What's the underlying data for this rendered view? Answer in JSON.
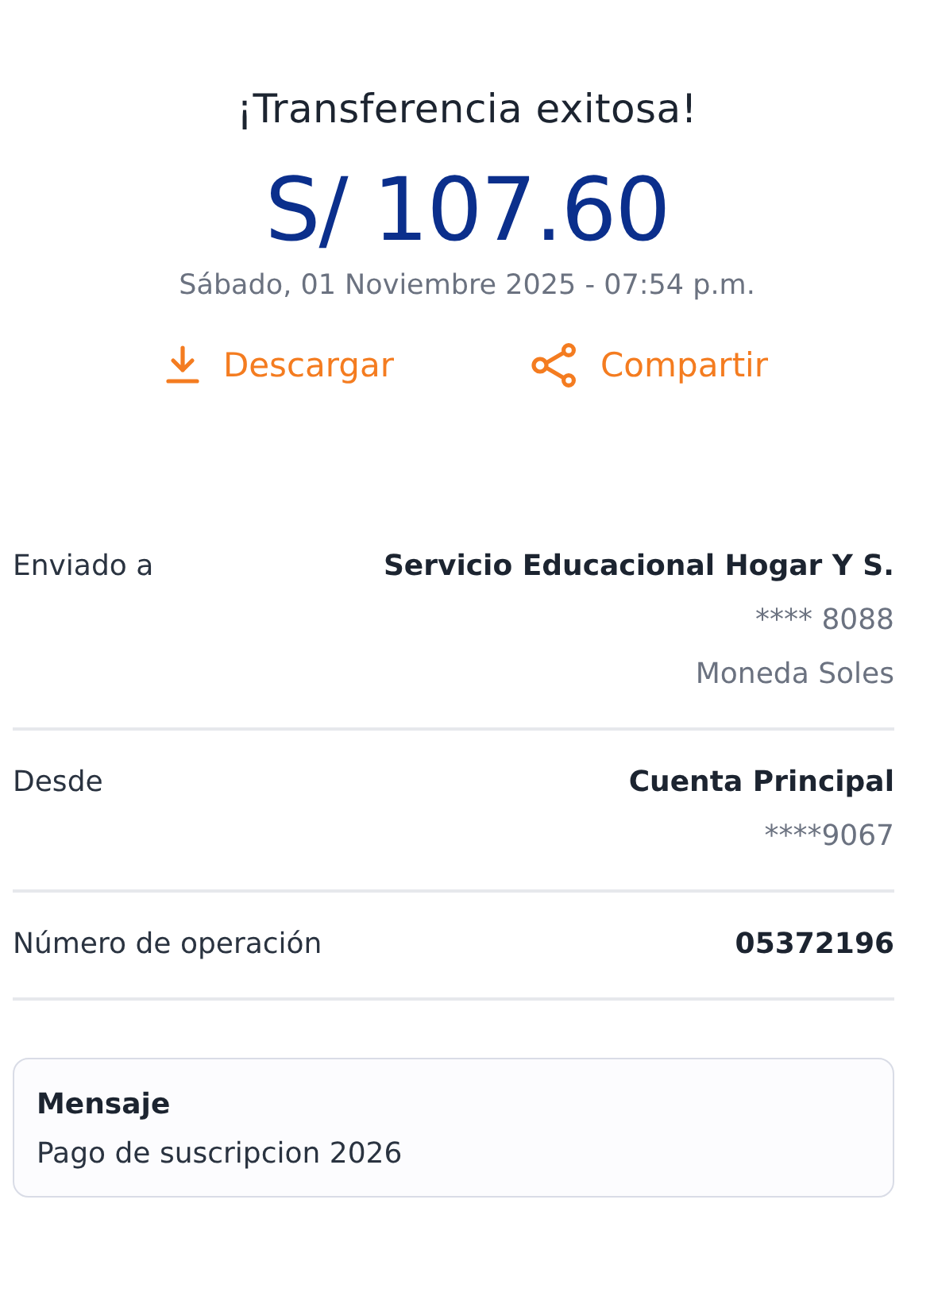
{
  "title": "¡Transferencia exitosa!",
  "amount": "S/ 107.60",
  "date": "Sábado, 01 Noviembre 2025 - 07:54 p.m.",
  "actions": [
    {
      "kind": "download",
      "label": "Descargar"
    },
    {
      "kind": "share",
      "label": "Compartir"
    }
  ],
  "details": [
    {
      "label": "Enviado a",
      "values": [
        {
          "text": "Servicio Educacional Hogar Y S.",
          "bold": true
        },
        {
          "text": "**** 8088",
          "bold": false
        },
        {
          "text": "Moneda Soles",
          "bold": false
        }
      ]
    },
    {
      "label": "Desde",
      "values": [
        {
          "text": "Cuenta Principal",
          "bold": true
        },
        {
          "text": "****9067",
          "bold": false
        }
      ]
    },
    {
      "label": "Número de operación",
      "values": [
        {
          "text": "05372196",
          "bold": true
        }
      ]
    }
  ],
  "message": {
    "title": "Mensaje",
    "text": "Pago de suscripcion 2026"
  }
}
